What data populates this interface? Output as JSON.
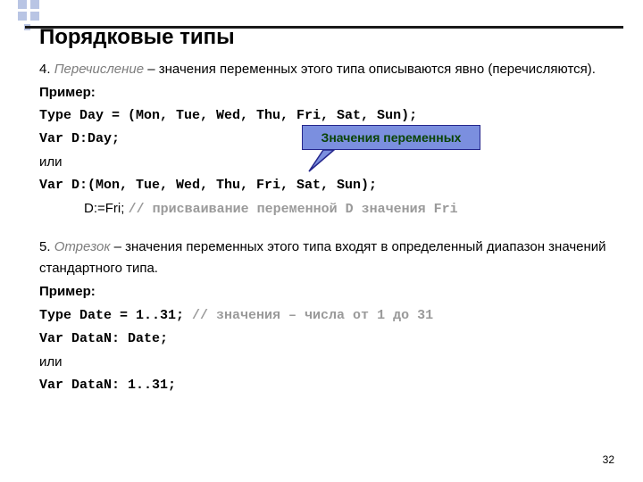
{
  "title": "Порядковые типы",
  "section4": {
    "num": "4. ",
    "term": "Перечисление",
    "rest": " – значения переменных этого типа описываются явно (перечисляются)."
  },
  "example_label": "Пример:",
  "code1": "Type Day = (Mon, Tue, Wed, Thu, Fri, Sat, Sun);",
  "code2": "Var D:Day;",
  "or_label": "или",
  "code3": "Var D:(Mon, Tue, Wed, Thu, Fri, Sat, Sun);",
  "code4a": "D:=Fri; ",
  "code4b": "// присваивание переменной D значения Fri",
  "section5": {
    "num": "5. ",
    "term": "Отрезок",
    "rest": " – значения переменных этого типа входят в определенный диапазон значений стандартного типа."
  },
  "code5a": "Type Date = 1..31; ",
  "code5b": "// значения – числа от 1 до 31",
  "code6": "Var DataN: Date;",
  "code7": "Var DataN: 1..31;",
  "callout": "Значения переменных",
  "pagenum": "32"
}
